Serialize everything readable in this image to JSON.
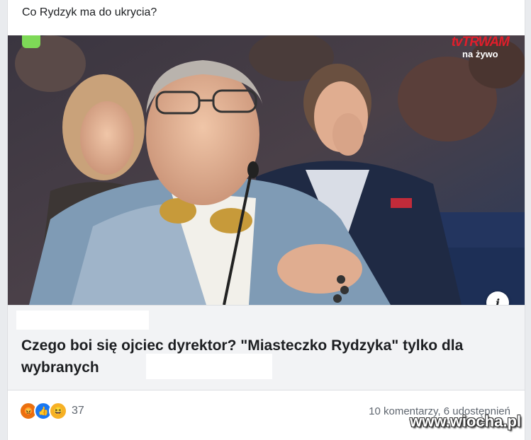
{
  "post": {
    "text": "Co Rydzyk ma do ukrycia?"
  },
  "media": {
    "channel_brand": "tvTRWAM",
    "channel_live": "na żywo",
    "info_icon": "info-icon"
  },
  "link": {
    "headline": "Czego boi się ojciec dyrektor? \"Miasteczko Rydzyka\" tylko dla wybranych"
  },
  "footer": {
    "reactions": [
      "angry-reaction-icon",
      "like-reaction-icon",
      "haha-reaction-icon"
    ],
    "reaction_count": "37",
    "stats": "10 komentarzy, 6 udostępnień"
  },
  "watermark": "www.wiocha.pl"
}
